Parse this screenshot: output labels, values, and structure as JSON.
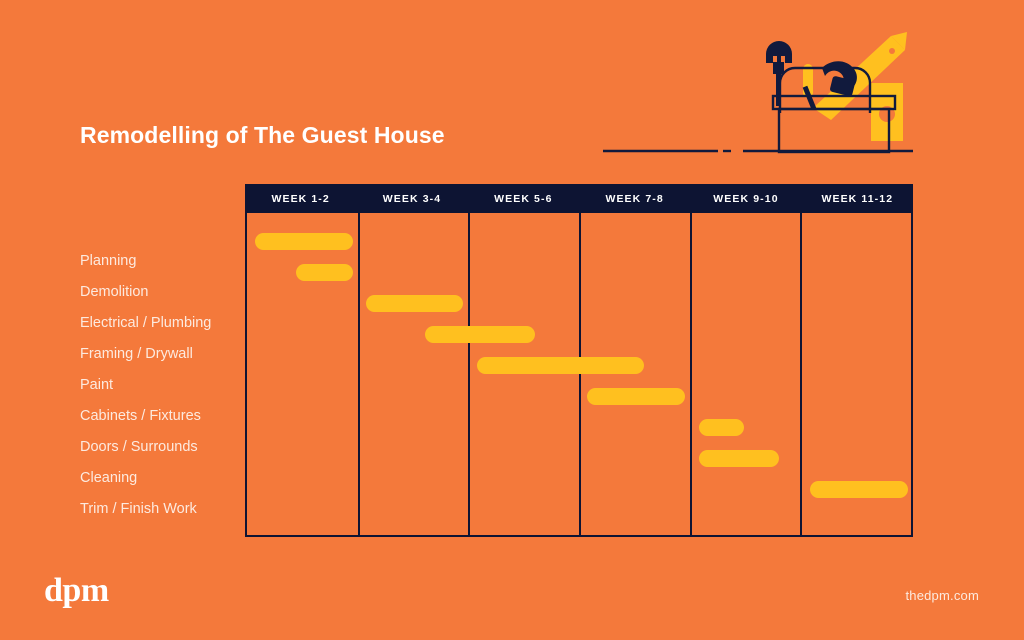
{
  "title": "Remodelling of The Guest House",
  "footer": {
    "logo": "dpm",
    "site": "thedpm.com"
  },
  "colors": {
    "background": "#f4793b",
    "bar": "#ffc01f",
    "grid": "#0d1433",
    "header_text": "#ffffff",
    "label_text": "#fdeadf"
  },
  "illustration": {
    "name": "toolbox-illustration",
    "parts": [
      "toolbox",
      "wrench-icon",
      "hammer-icon",
      "saw-icon",
      "screwdriver-icon",
      "tape-measure-icon",
      "ground-line"
    ]
  },
  "chart_data": {
    "type": "bar",
    "title": "Remodelling of The Guest House",
    "xlabel": "",
    "ylabel": "",
    "orientation": "horizontal",
    "grid": true,
    "legend": false,
    "columns": [
      "WEEK 1-2",
      "WEEK 3-4",
      "WEEK 5-6",
      "WEEK 7-8",
      "WEEK 9-10",
      "WEEK 11-12"
    ],
    "categories": [
      "Planning",
      "Demolition",
      "Electrical / Plumbing",
      "Framing / Drywall",
      "Paint",
      "Cabinets / Fixtures",
      "Doors / Surrounds",
      "Cleaning",
      "Trim / Finish Work"
    ],
    "xlim": [
      0,
      12
    ],
    "xunit": "weeks",
    "tasks": [
      {
        "label": "Planning",
        "start_week": 0.2,
        "end_week": 1.9,
        "row": 0,
        "left_pct": 1.2,
        "width_pct": 14.7
      },
      {
        "label": "Demolition",
        "start_week": 0.95,
        "end_week": 1.9,
        "row": 1,
        "left_pct": 7.4,
        "width_pct": 8.5
      },
      {
        "label": "Electrical / Plumbing",
        "start_week": 2.2,
        "end_week": 3.9,
        "row": 2,
        "left_pct": 17.9,
        "width_pct": 14.7
      },
      {
        "label": "Framing / Drywall",
        "start_week": 3.2,
        "end_week": 5.2,
        "row": 3,
        "left_pct": 26.8,
        "width_pct": 16.6
      },
      {
        "label": "Paint",
        "start_week": 4.2,
        "end_week": 7.2,
        "row": 4,
        "left_pct": 34.6,
        "width_pct": 25.2
      },
      {
        "label": "Cabinets / Fixtures",
        "start_week": 6.2,
        "end_week": 7.9,
        "row": 5,
        "left_pct": 51.2,
        "width_pct": 14.7
      },
      {
        "label": "Doors / Surrounds",
        "start_week": 8.2,
        "end_week": 9.0,
        "row": 6,
        "left_pct": 68.0,
        "width_pct": 6.9
      },
      {
        "label": "Cleaning",
        "start_week": 8.2,
        "end_week": 9.6,
        "row": 7,
        "left_pct": 68.0,
        "width_pct": 12.1
      },
      {
        "label": "Trim / Finish Work",
        "start_week": 10.2,
        "end_week": 11.9,
        "row": 8,
        "left_pct": 84.8,
        "width_pct": 14.7
      }
    ]
  }
}
